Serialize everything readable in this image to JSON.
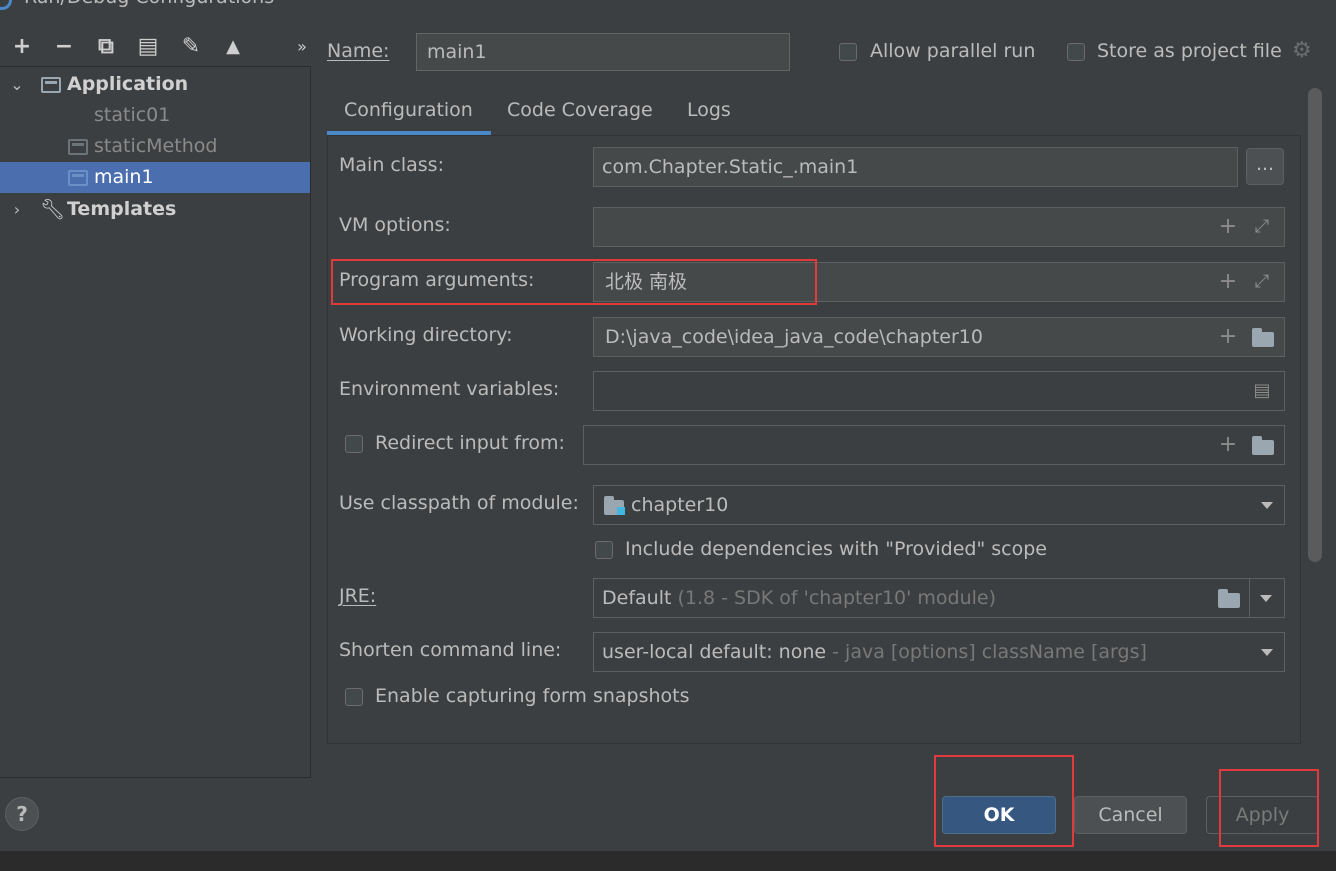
{
  "window": {
    "title": "Run/Debug Configurations"
  },
  "toolbar": {
    "add": "+",
    "remove": "−",
    "copy": "⧉",
    "save": "▤",
    "edit": "✎",
    "move_up": "▲",
    "more": "»"
  },
  "tree": {
    "application": "Application",
    "items": [
      "static01",
      "staticMethod",
      "main1"
    ],
    "templates": "Templates"
  },
  "header": {
    "name_label": "Name:",
    "name_value": "main1",
    "allow_parallel": "Allow parallel run",
    "store_project": "Store as project file"
  },
  "tabs": [
    "Configuration",
    "Code Coverage",
    "Logs"
  ],
  "config": {
    "main_class_label": "Main class:",
    "main_class_value": "com.Chapter.Static_.main1",
    "browse": "...",
    "vm_label": "VM options:",
    "vm_value": "",
    "program_args_label": "Program arguments:",
    "program_args_value": "北极  南极",
    "working_dir_label": "Working directory:",
    "working_dir_value": "D:\\java_code\\idea_java_code\\chapter10",
    "env_label": "Environment variables:",
    "env_value": "",
    "redirect_label": "Redirect input from:",
    "classpath_label": "Use classpath of module:",
    "classpath_value": "chapter10",
    "include_deps": "Include dependencies with \"Provided\" scope",
    "jre_label": "JRE:",
    "jre_value": "Default",
    "jre_hint": "(1.8 - SDK of 'chapter10' module)",
    "shorten_label": "Shorten command line:",
    "shorten_value": "user-local default: none",
    "shorten_hint": "- java [options] className [args]",
    "capture_label": "Enable capturing form snapshots"
  },
  "buttons": {
    "help": "?",
    "ok": "OK",
    "cancel": "Cancel",
    "apply": "Apply"
  },
  "colors": {
    "accent": "#4a88c7",
    "selection": "#4b6eaf",
    "highlight": "#e03a3a",
    "background": "#3c3f41"
  }
}
